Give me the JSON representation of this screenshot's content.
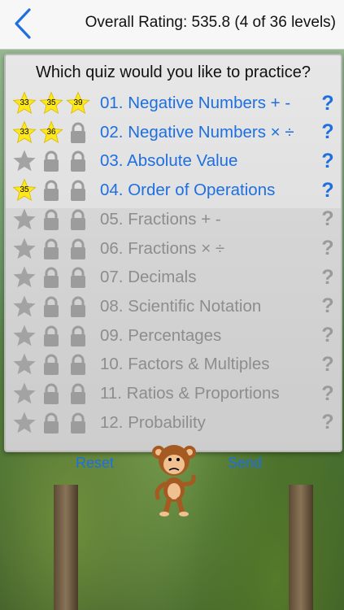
{
  "header": {
    "back_icon": "chevron-left-icon",
    "rating_text": "Overall Rating: 535.8 (4 of 36 levels)"
  },
  "sign": {
    "question": "Which quiz would you like to practice?",
    "quizzes": [
      {
        "title": "01. Negative Numbers + -",
        "status": "unlocked",
        "badges": [
          {
            "type": "gold",
            "score": "33"
          },
          {
            "type": "gold",
            "score": "35"
          },
          {
            "type": "gold",
            "score": "39"
          }
        ]
      },
      {
        "title": "02. Negative Numbers × ÷",
        "status": "unlocked",
        "badges": [
          {
            "type": "gold",
            "score": "33"
          },
          {
            "type": "gold",
            "score": "36"
          },
          {
            "type": "lock-gray"
          }
        ]
      },
      {
        "title": "03. Absolute Value",
        "status": "unlocked",
        "badges": [
          {
            "type": "star-gray"
          },
          {
            "type": "lock-gray"
          },
          {
            "type": "lock-gray"
          }
        ]
      },
      {
        "title": "04. Order of Operations",
        "status": "unlocked",
        "badges": [
          {
            "type": "gold",
            "score": "35"
          },
          {
            "type": "lock-gray"
          },
          {
            "type": "lock-gray"
          }
        ]
      },
      {
        "title": "05. Fractions + -",
        "status": "locked",
        "badges": [
          {
            "type": "star-gray"
          },
          {
            "type": "lock-gray"
          },
          {
            "type": "lock-gray"
          }
        ]
      },
      {
        "title": "06. Fractions × ÷",
        "status": "locked",
        "badges": [
          {
            "type": "star-gray"
          },
          {
            "type": "lock-gray"
          },
          {
            "type": "lock-gray"
          }
        ]
      },
      {
        "title": "07. Decimals",
        "status": "locked",
        "badges": [
          {
            "type": "star-gray"
          },
          {
            "type": "lock-gray"
          },
          {
            "type": "lock-gray"
          }
        ]
      },
      {
        "title": "08. Scientific Notation",
        "status": "locked",
        "badges": [
          {
            "type": "star-gray"
          },
          {
            "type": "lock-gray"
          },
          {
            "type": "lock-gray"
          }
        ]
      },
      {
        "title": "09. Percentages",
        "status": "locked",
        "badges": [
          {
            "type": "star-gray"
          },
          {
            "type": "lock-gray"
          },
          {
            "type": "lock-gray"
          }
        ]
      },
      {
        "title": "10. Factors & Multiples",
        "status": "locked",
        "badges": [
          {
            "type": "star-gray"
          },
          {
            "type": "lock-gray"
          },
          {
            "type": "lock-gray"
          }
        ]
      },
      {
        "title": "11. Ratios & Proportions",
        "status": "locked",
        "badges": [
          {
            "type": "star-gray"
          },
          {
            "type": "lock-gray"
          },
          {
            "type": "lock-gray"
          }
        ]
      },
      {
        "title": "12. Probability",
        "status": "locked",
        "badges": [
          {
            "type": "star-gray"
          },
          {
            "type": "lock-gray"
          },
          {
            "type": "lock-gray"
          }
        ]
      }
    ],
    "help_symbol": "?",
    "reset_label": "Reset",
    "send_label": "Send",
    "mascot_icon": "monkey-icon"
  },
  "colors": {
    "accent": "#1e6fe0",
    "gold_star": "#ffe81a",
    "locked_text": "#8d8d8d"
  }
}
